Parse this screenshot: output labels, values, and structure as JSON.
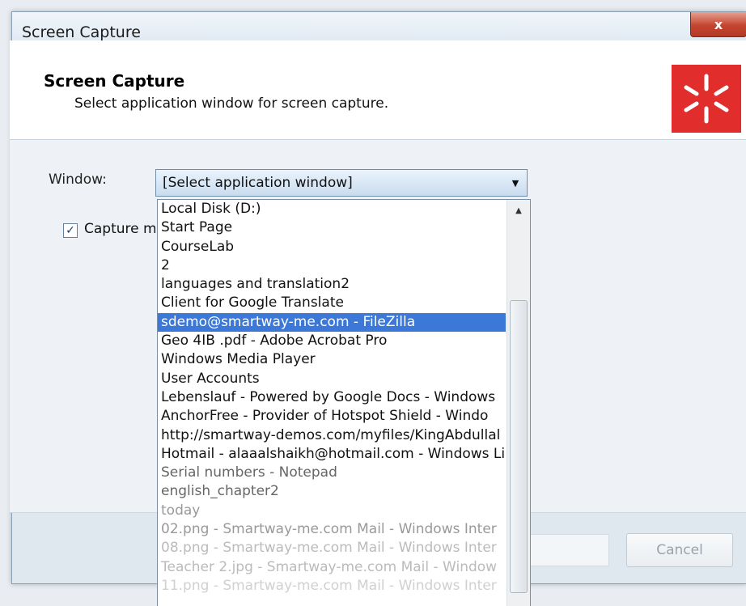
{
  "window": {
    "title": "Screen Capture",
    "close_label": "x"
  },
  "header": {
    "title": "Screen Capture",
    "subtitle": "Select application window for screen capture."
  },
  "form": {
    "window_label": "Window:",
    "window_select_value": "[Select application window]",
    "capture_checkbox_label": "Capture m",
    "capture_checked": true
  },
  "dropdown": {
    "items": [
      "Local Disk (D:)",
      "Start Page",
      "CourseLab",
      "2",
      "languages and translation2",
      "Client for Google Translate",
      "sdemo@smartway-me.com - FileZilla",
      "Geo 4IB .pdf - Adobe Acrobat Pro",
      "Windows Media Player",
      "User Accounts",
      "Lebenslauf - Powered by Google Docs - Windows",
      "AnchorFree - Provider of Hotspot Shield - Windo",
      "http://smartway-demos.com/myfiles/KingAbdullal",
      "Hotmail - alaaalshaikh@hotmail.com - Windows Li",
      "Serial numbers - Notepad",
      "english_chapter2",
      "today",
      "02.png - Smartway-me.com Mail - Windows Inter",
      "08.png - Smartway-me.com Mail - Windows Inter",
      "Teacher 2.jpg - Smartway-me.com Mail - Window",
      "11.png - Smartway-me.com Mail - Windows Inter"
    ],
    "selected_index": 6
  },
  "footer": {
    "cancel_label": "Cancel"
  },
  "colors": {
    "accent_logo": "#e22d2d",
    "selection": "#3b78d8"
  }
}
